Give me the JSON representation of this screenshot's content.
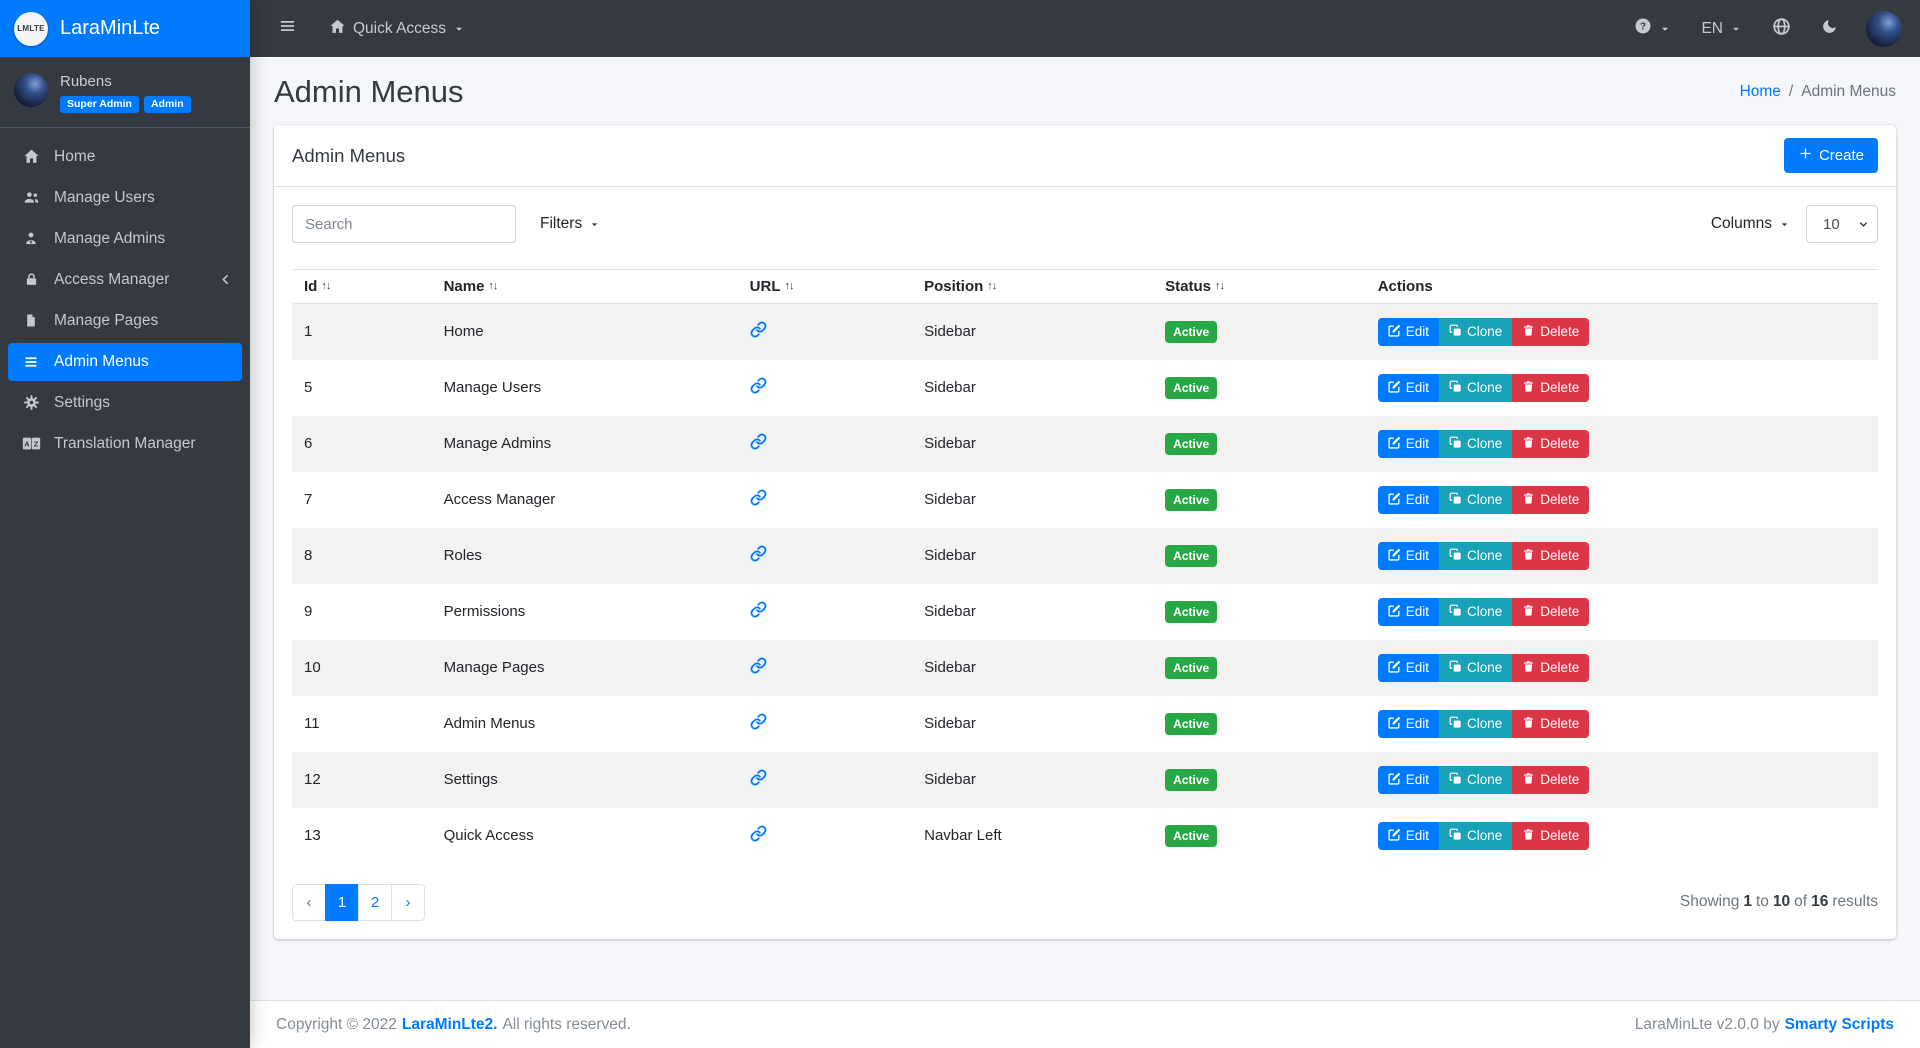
{
  "brand": {
    "logo_text": "LMLTE",
    "name": "LaraMinLte"
  },
  "navbar": {
    "quick_access_label": "Quick Access",
    "language_label": "EN"
  },
  "sidebar": {
    "user": {
      "name": "Rubens",
      "badges": [
        "Super Admin",
        "Admin"
      ]
    },
    "items": [
      {
        "label": "Home",
        "icon": "home-icon",
        "active": false
      },
      {
        "label": "Manage Users",
        "icon": "users-icon",
        "active": false
      },
      {
        "label": "Manage Admins",
        "icon": "user-tie-icon",
        "active": false
      },
      {
        "label": "Access Manager",
        "icon": "lock-icon",
        "active": false,
        "collapsible": true
      },
      {
        "label": "Manage Pages",
        "icon": "file-icon",
        "active": false
      },
      {
        "label": "Admin Menus",
        "icon": "bars-icon",
        "active": true
      },
      {
        "label": "Settings",
        "icon": "gear-icon",
        "active": false
      },
      {
        "label": "Translation Manager",
        "icon": "language-icon",
        "active": false
      }
    ]
  },
  "page": {
    "title": "Admin Menus",
    "breadcrumb": {
      "home": "Home",
      "separator": "/",
      "current": "Admin Menus"
    }
  },
  "card": {
    "title": "Admin Menus",
    "create_label": "Create",
    "search_placeholder": "Search",
    "filters_label": "Filters",
    "columns_label": "Columns",
    "page_size": "10",
    "table": {
      "headers": [
        {
          "label": "Id",
          "sortable": true
        },
        {
          "label": "Name",
          "sortable": true
        },
        {
          "label": "URL",
          "sortable": true
        },
        {
          "label": "Position",
          "sortable": true
        },
        {
          "label": "Status",
          "sortable": true
        },
        {
          "label": "Actions",
          "sortable": false
        }
      ],
      "rows": [
        {
          "id": "1",
          "name": "Home",
          "url_icon": "link-icon",
          "position": "Sidebar",
          "status": "Active"
        },
        {
          "id": "5",
          "name": "Manage Users",
          "url_icon": "link-icon",
          "position": "Sidebar",
          "status": "Active"
        },
        {
          "id": "6",
          "name": "Manage Admins",
          "url_icon": "link-icon",
          "position": "Sidebar",
          "status": "Active"
        },
        {
          "id": "7",
          "name": "Access Manager",
          "url_icon": "link-icon",
          "position": "Sidebar",
          "status": "Active"
        },
        {
          "id": "8",
          "name": "Roles",
          "url_icon": "link-icon",
          "position": "Sidebar",
          "status": "Active"
        },
        {
          "id": "9",
          "name": "Permissions",
          "url_icon": "link-icon",
          "position": "Sidebar",
          "status": "Active"
        },
        {
          "id": "10",
          "name": "Manage Pages",
          "url_icon": "link-icon",
          "position": "Sidebar",
          "status": "Active"
        },
        {
          "id": "11",
          "name": "Admin Menus",
          "url_icon": "link-icon",
          "position": "Sidebar",
          "status": "Active"
        },
        {
          "id": "12",
          "name": "Settings",
          "url_icon": "link-icon",
          "position": "Sidebar",
          "status": "Active"
        },
        {
          "id": "13",
          "name": "Quick Access",
          "url_icon": "link-icon",
          "position": "Navbar Left",
          "status": "Active"
        }
      ],
      "actions": {
        "edit": "Edit",
        "clone": "Clone",
        "delete": "Delete"
      }
    },
    "pagination": {
      "prev": "‹",
      "pages": [
        "1",
        "2"
      ],
      "current": "1",
      "next": "›",
      "summary": {
        "prefix": "Showing",
        "from": "1",
        "to_word": "to",
        "to": "10",
        "of_word": "of",
        "total": "16",
        "suffix": "results"
      }
    }
  },
  "footer": {
    "copyright_prefix": "Copyright © 2022",
    "brand_link": "LaraMinLte2.",
    "copyright_suffix": "All rights reserved.",
    "version_text": "LaraMinLte v2.0.0 by",
    "vendor_link": "Smarty Scripts"
  },
  "colors": {
    "primary": "#007bff",
    "dark": "#343a40",
    "success": "#28a745",
    "info": "#17a2b8",
    "danger": "#dc3545",
    "body_bg": "#f4f6f9",
    "stripe": "#f2f2f2"
  }
}
